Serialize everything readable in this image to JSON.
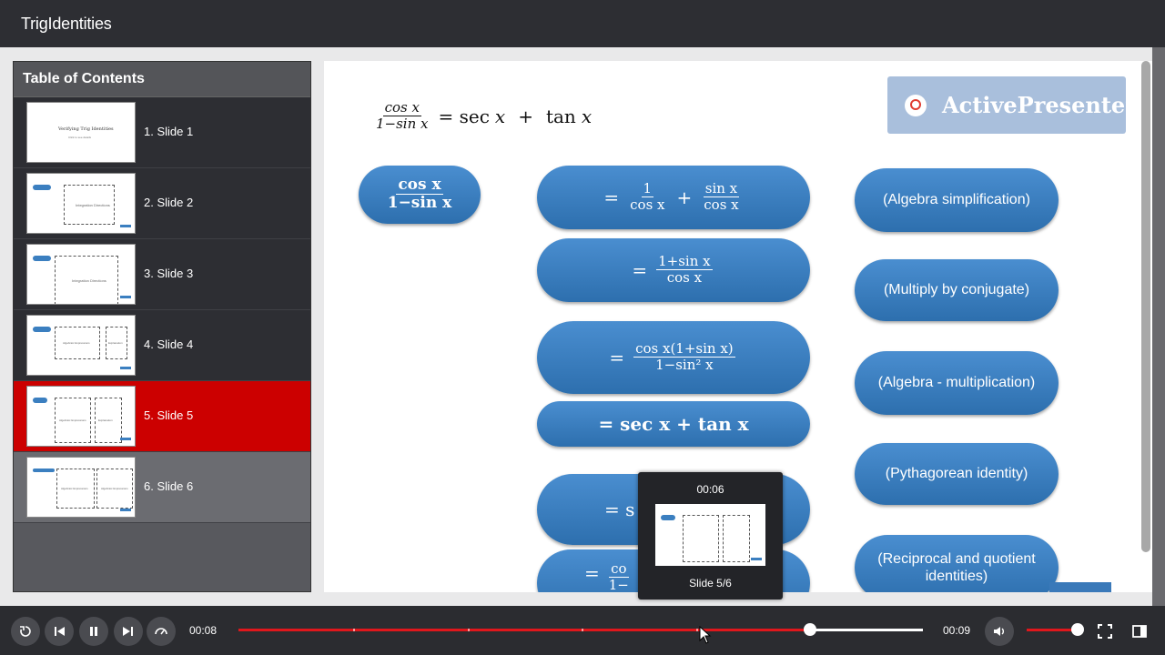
{
  "app": {
    "title": "TrigIdentities"
  },
  "toc": {
    "header": "Table of Contents",
    "items": [
      {
        "label": "1. Slide 1",
        "thumb_title": "Verifying Trig Identities",
        "thumb_sub": "Click to see details"
      },
      {
        "label": "2. Slide 2",
        "thumb_box": "Integration Directions"
      },
      {
        "label": "3. Slide 3",
        "thumb_box": "Integration Directions"
      },
      {
        "label": "4. Slide 4",
        "thumb_box1": "Algebraic Expressions",
        "thumb_box2": "Explanation"
      },
      {
        "label": "5. Slide 5",
        "thumb_box1": "Algebraic Expressions",
        "thumb_box2": "Explanation"
      },
      {
        "label": "6. Slide 6",
        "thumb_box1": "Algebraic Expressions",
        "thumb_box2": "Algebraic Expressions"
      }
    ],
    "active_index": 4
  },
  "slide": {
    "logo_text": "ActivePresenter",
    "heading": {
      "num": "cos x",
      "den": "1−sin x",
      "rhs_a": "= sec",
      "rhs_x": "x",
      "plus": "+",
      "rhs_b": "tan",
      "rhs_x2": "x"
    },
    "start_bubble": {
      "num": "cos x",
      "den": "1−sin x"
    },
    "steps": [
      {
        "eq": "=",
        "num1": "1",
        "den1": "cos x",
        "plus": "+",
        "num2": "sin x",
        "den2": "cos x"
      },
      {
        "eq": "=",
        "num": "1+sin x",
        "den": "cos x"
      },
      {
        "eq": "=",
        "num": "cos x(1+sin x)",
        "den": "1−sin² x"
      },
      {
        "text": "= sec x + tan x"
      },
      {
        "text": "= s"
      },
      {
        "eq": "=",
        "num": "co",
        "den": "1−"
      }
    ],
    "notes": [
      "(Algebra simplification)",
      "(Multiply by conjugate)",
      "(Algebra - multiplication)",
      "(Pythagorean identity)",
      "(Reciprocal and quotient identities)"
    ]
  },
  "tooltip": {
    "time": "00:06",
    "caption": "Slide 5/6"
  },
  "player": {
    "current_time": "00:08",
    "total_time": "00:09",
    "progress": 0.835,
    "volume": 0.9,
    "accent_color": "#e0171c"
  },
  "icons": [
    "replay-icon",
    "rewind-icon",
    "pause-icon",
    "forward-icon",
    "speed-icon",
    "volume-icon",
    "fullscreen-icon",
    "sidebar-toggle-icon"
  ]
}
